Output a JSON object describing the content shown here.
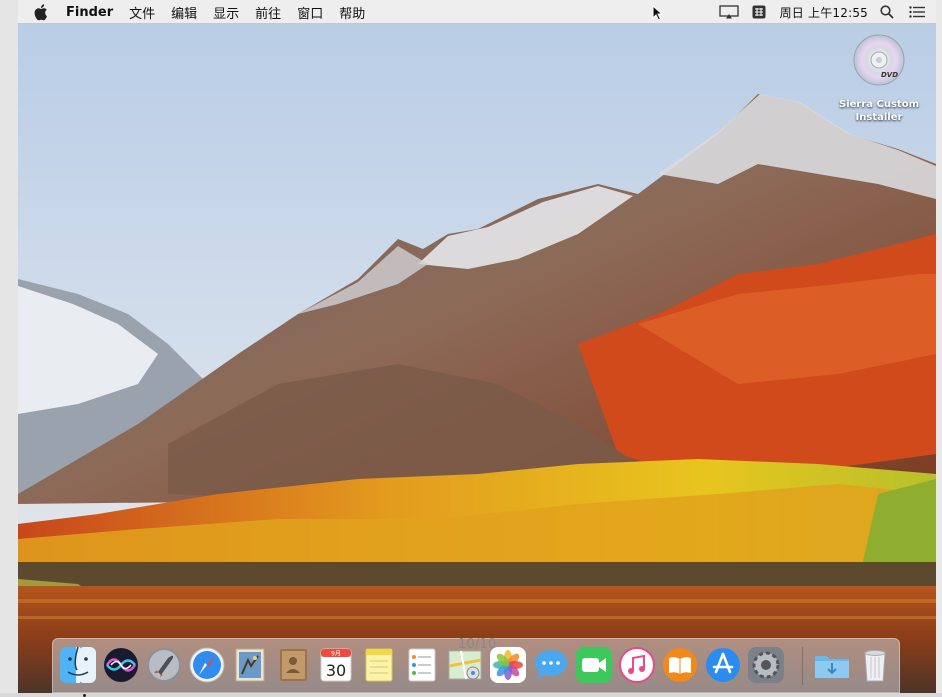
{
  "menubar": {
    "app_name": "Finder",
    "items": [
      "文件",
      "编辑",
      "显示",
      "前往",
      "窗口",
      "帮助"
    ],
    "clock": "周日 上午12:55"
  },
  "desktop_icon": {
    "label_line1": "Sierra Custom",
    "label_line2": "Installer"
  },
  "dock": {
    "counter": "10/10",
    "calendar": {
      "month": "9月",
      "day": "30"
    },
    "apps": [
      "finder",
      "siri",
      "launchpad",
      "safari",
      "mail",
      "contacts",
      "calendar",
      "notes",
      "reminders",
      "maps",
      "photos",
      "messages",
      "facetime",
      "itunes",
      "ibooks",
      "app-store",
      "system-preferences",
      "downloads",
      "trash"
    ]
  }
}
